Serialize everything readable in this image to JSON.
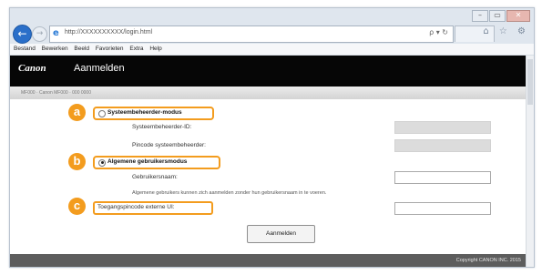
{
  "browser": {
    "window_controls": {
      "minimize": "–",
      "maximize": "▭",
      "close": "✕"
    },
    "back_icon": "←",
    "forward_icon": "→",
    "ie_icon": "e",
    "url": "http://XXXXXXXXXX/login.html",
    "address_controls": "ρ ▾ ↻",
    "toolbar_icons": "⌂ ☆ ⚙",
    "menu": [
      "Bestand",
      "Bewerken",
      "Beeld",
      "Favorieten",
      "Extra",
      "Help"
    ]
  },
  "header": {
    "brand": "Canon",
    "title": "Aanmelden"
  },
  "subbar": {
    "text": "MF000 · Canon MF000 · 000 0000"
  },
  "form": {
    "admin_mode": {
      "label": "Systeembeheerder-modus",
      "marker": "a",
      "selected": false
    },
    "admin_id_label": "Systeembeheerder-ID:",
    "admin_pin_label": "Pincode systeembeheerder:",
    "general_mode": {
      "label": "Algemene gebruikersmodus",
      "marker": "b",
      "selected": true
    },
    "username_label": "Gebruikersnaam:",
    "general_note": "Algemene gebruikers kunnen zich aanmelden zonder hun gebruikersnaam in te voeren.",
    "remote_pin": {
      "label": "Toegangspincode externe UI:",
      "marker": "c"
    },
    "login_button": "Aanmelden"
  },
  "footer": {
    "copyright": "Copyright CANON INC. 2015"
  },
  "colors": {
    "accent": "#f39c1e",
    "header": "#060606",
    "footer": "#5d5d5d"
  }
}
